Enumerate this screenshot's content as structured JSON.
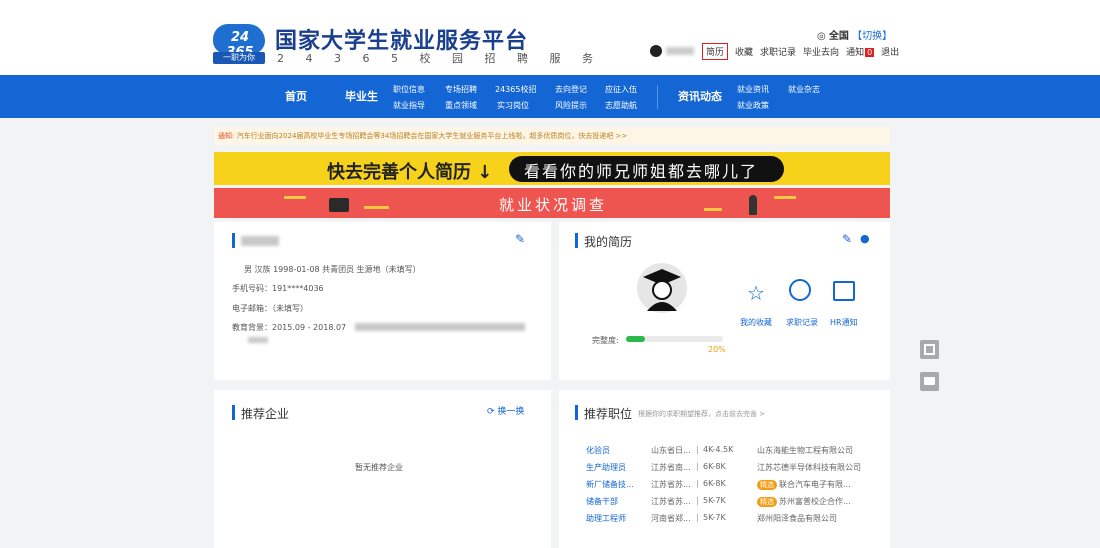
{
  "header": {
    "logo_number": "24 365",
    "logo_slogan": "一职为你",
    "site_title": "国家大学生就业服务平台",
    "site_subtitle": "2 4 3 6 5 校 园 招 聘 服 务",
    "region": "全国",
    "region_switch": "【切换】",
    "user_nav": [
      {
        "label": "简历",
        "highlight": true
      },
      {
        "label": "收藏"
      },
      {
        "label": "求职记录"
      },
      {
        "label": "毕业去向"
      },
      {
        "label": "通知"
      },
      {
        "label": "退出"
      }
    ],
    "notice_badge": "0"
  },
  "nav": {
    "home": "首页",
    "graduate": "毕业生",
    "job_info": "职位信息",
    "career_guide": "就业指导",
    "special_recruit": "专场招聘",
    "key_fields": "重点领域",
    "campus_24365": "24365校招",
    "internship": "实习岗位",
    "destination_register": "去向登记",
    "risk_tips": "风险提示",
    "enlist": "应征入伍",
    "volunteer": "志愿助航",
    "news": "资讯动态",
    "employment_news": "就业资讯",
    "employment_policy": "就业政策",
    "employment_magazine": "就业杂志"
  },
  "notice": {
    "label": "通知:",
    "text": "汽车行业面向2024届高校毕业生专场招聘会等34场招聘会在国家大学生就业服务平台上线啦，超多优质岗位，快去投递吧 >>"
  },
  "banner": {
    "left": "快去完善个人简历 ↓",
    "pill": "看看你的师兄师姐都去哪儿了",
    "survey": "就业状况调查"
  },
  "profile": {
    "info_line": "男  汉族  1998-01-08  共青团员  生源地（未填写）",
    "phone": "手机号码：191****4036",
    "email": "电子邮箱：（未填写）",
    "education": "教育背景：2015.09 - 2018.07"
  },
  "resume": {
    "title": "我的简历",
    "completeness_label": "完整度:",
    "completeness_value": "20%",
    "completeness": 0.2,
    "actions": [
      {
        "label": "我的收藏",
        "icon": "star-icon"
      },
      {
        "label": "求职记录",
        "icon": "clock-icon"
      },
      {
        "label": "HR通知",
        "icon": "envelope-icon"
      }
    ]
  },
  "companies": {
    "title": "推荐企业",
    "refresh": "换一换",
    "empty": "暂无推荐企业"
  },
  "jobs": {
    "title": "推荐职位",
    "hint": "根据你的求职期望推荐，点击前去完善 >",
    "rows": [
      {
        "title": "化验员",
        "location": "山东省日...",
        "salary": "4K-4.5K",
        "company": "山东海能生物工程有限公司",
        "featured": false
      },
      {
        "title": "生产助理员",
        "location": "江苏省南...",
        "salary": "6K-8K",
        "company": "江苏芯德半导体科技有限公司",
        "featured": false
      },
      {
        "title": "新厂储备技...",
        "location": "江苏省苏...",
        "salary": "6K-8K",
        "company": "联合汽车电子有限...",
        "featured": true
      },
      {
        "title": "储备干部",
        "location": "江苏省苏...",
        "salary": "5K-7K",
        "company": "苏州富普校企合作...",
        "featured": true
      },
      {
        "title": "助理工程师",
        "location": "河南省郑...",
        "salary": "5K-7K",
        "company": "郑州阳泽食品有限公司",
        "featured": false
      }
    ],
    "featured_tag": "精选"
  },
  "colors": {
    "primary": "#1466d4",
    "banner_yellow": "#f7d21b",
    "banner_red": "#ef5550",
    "progress": "#2db84d"
  }
}
